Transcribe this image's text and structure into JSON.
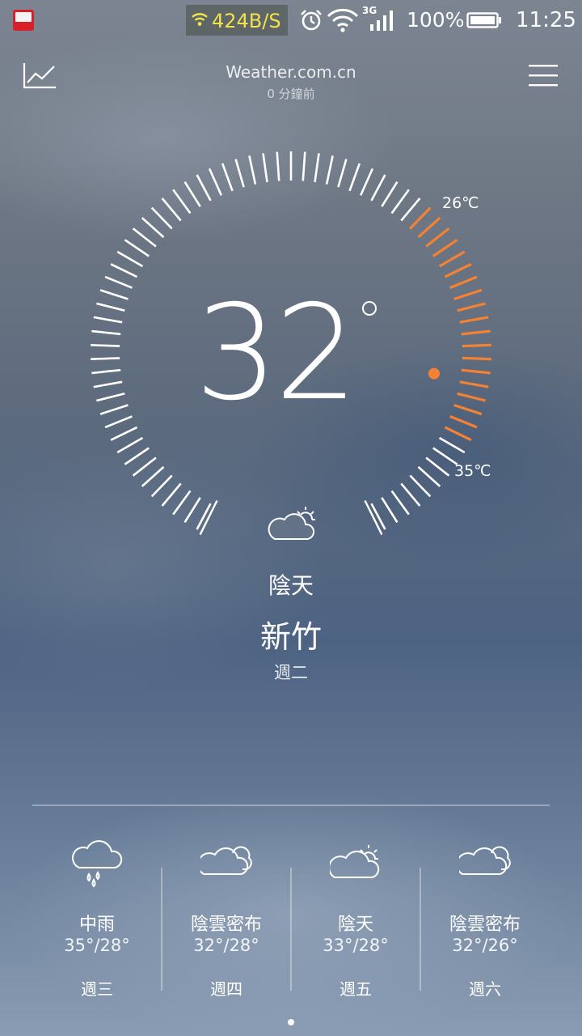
{
  "status_bar": {
    "net_speed": "424B/S",
    "network_type": "3G",
    "battery": "100%",
    "time": "11:25",
    "icons": [
      "app-notification-icon",
      "wifi-hotspot-icon",
      "alarm-icon",
      "wifi-icon",
      "signal-icon",
      "battery-icon"
    ]
  },
  "header": {
    "source": "Weather.com.cn",
    "updated": "0 分鐘前",
    "left_icon": "trend-chart-icon",
    "right_icon": "menu-icon"
  },
  "current": {
    "temperature": "32",
    "high_label": "26℃",
    "low_label": "35℃",
    "condition": "陰天",
    "condition_icon": "partly-cloudy-icon",
    "city": "新竹",
    "weekday": "週二"
  },
  "colors": {
    "accent": "#f58233",
    "text": "#ffffff"
  },
  "forecast": [
    {
      "condition": "中雨",
      "temps": "35°/28°",
      "day": "週三",
      "icon": "rain-icon"
    },
    {
      "condition": "陰雲密布",
      "temps": "32°/28°",
      "day": "週四",
      "icon": "cloudy-icon"
    },
    {
      "condition": "陰天",
      "temps": "33°/28°",
      "day": "週五",
      "icon": "partly-cloudy-icon"
    },
    {
      "condition": "陰雲密布",
      "temps": "32°/26°",
      "day": "週六",
      "icon": "cloudy-icon"
    }
  ],
  "pager": {
    "pages": 1,
    "current": 1
  }
}
